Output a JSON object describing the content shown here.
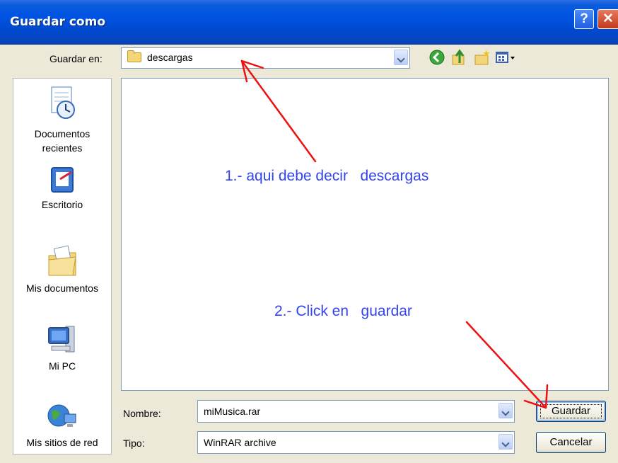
{
  "window": {
    "title": "Guardar como",
    "help_glyph": "?",
    "close_glyph": "✕"
  },
  "location": {
    "label": "Guardar en:",
    "value": "descargas"
  },
  "toolbar": {
    "icons": [
      "back-icon",
      "up-folder-icon",
      "new-folder-icon",
      "views-menu-icon"
    ]
  },
  "sidebar": {
    "items": [
      {
        "label_line1": "Documentos",
        "label_line2": "recientes",
        "icon": "recent-documents-icon"
      },
      {
        "label_line1": "Escritorio",
        "label_line2": "",
        "icon": "desktop-icon"
      },
      {
        "label_line1": "Mis documentos",
        "label_line2": "",
        "icon": "my-documents-icon"
      },
      {
        "label_line1": "Mi PC",
        "label_line2": "",
        "icon": "my-computer-icon"
      },
      {
        "label_line1": "Mis sitios de red",
        "label_line2": "",
        "icon": "network-places-icon"
      }
    ]
  },
  "annotations": {
    "step1": "1.- aqui debe decir   descargas",
    "step2": "2.- Click en   guardar",
    "arrow_color": "#ee1111",
    "text_color": "#3344ee"
  },
  "filename": {
    "label": "Nombre:",
    "value": "miMusica.rar"
  },
  "filetype": {
    "label": "Tipo:",
    "value": "WinRAR archive"
  },
  "buttons": {
    "save": "Guardar",
    "cancel": "Cancelar"
  },
  "colors": {
    "titlebar": "#0054e3",
    "dialog_bg": "#ECE9D8"
  }
}
